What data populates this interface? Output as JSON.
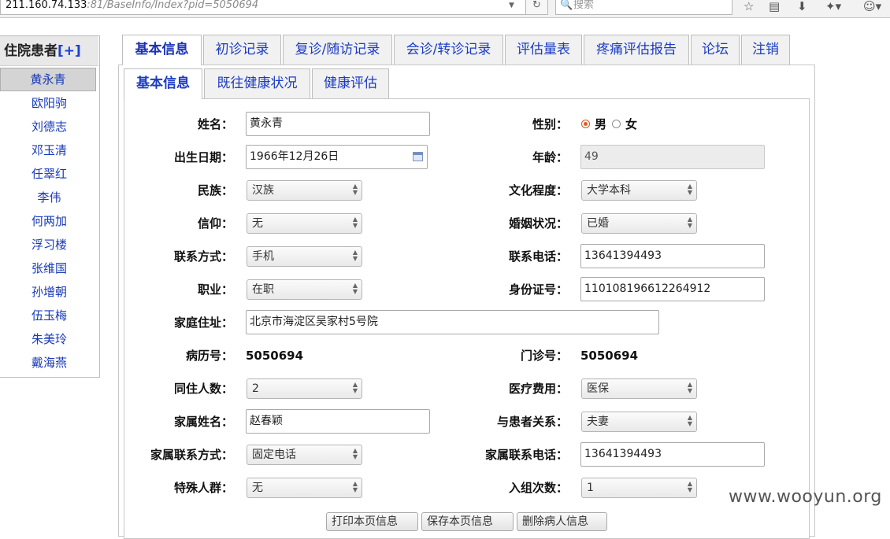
{
  "browser": {
    "url_host": "211.160.74.133",
    "url_rest": ":81/BaseInfo/Index?pid=5050694",
    "search_placeholder": "搜索"
  },
  "sidebar": {
    "title": "住院患者",
    "add_label": "[+]",
    "patients": [
      "黄永青",
      "欧阳驹",
      "刘德志",
      "邓玉清",
      "任翠红",
      "李伟",
      "何两加",
      "浮习楼",
      "张维国",
      "孙增朝",
      "伍玉梅",
      "朱美玲",
      "戴海燕"
    ]
  },
  "tabs": [
    "基本信息",
    "初诊记录",
    "复诊/随访记录",
    "会诊/转诊记录",
    "评估量表",
    "疼痛评估报告",
    "论坛",
    "注销"
  ],
  "subtabs": [
    "基本信息",
    "既往健康状况",
    "健康评估"
  ],
  "form": {
    "name_label": "姓名：",
    "name_value": "黄永青",
    "gender_label": "性别：",
    "gender_male": "男",
    "gender_female": "女",
    "birth_label": "出生日期：",
    "birth_value": "1966年12月26日",
    "age_label": "年龄：",
    "age_value": "49",
    "ethnic_label": "民族：",
    "ethnic_value": "汉族",
    "edu_label": "文化程度：",
    "edu_value": "大学本科",
    "faith_label": "信仰：",
    "faith_value": "无",
    "marital_label": "婚姻状况：",
    "marital_value": "已婚",
    "contact_label": "联系方式：",
    "contact_value": "手机",
    "phone_label": "联系电话：",
    "phone_value": "13641394493",
    "job_label": "职业：",
    "job_value": "在职",
    "id_label": "身份证号：",
    "id_value": "110108196612264912",
    "address_label": "家庭住址：",
    "address_value": "北京市海淀区吴家村5号院",
    "record_label": "病历号：",
    "record_value": "5050694",
    "clinic_label": "门诊号：",
    "clinic_value": "5050694",
    "cohab_label": "同住人数：",
    "cohab_value": "2",
    "fee_label": "医疗费用：",
    "fee_value": "医保",
    "family_name_label": "家属姓名：",
    "family_name_value": "赵春颖",
    "relation_label": "与患者关系：",
    "relation_value": "夫妻",
    "family_contact_label": "家属联系方式：",
    "family_contact_value": "固定电话",
    "family_phone_label": "家属联系电话：",
    "family_phone_value": "13641394493",
    "special_label": "特殊人群：",
    "special_value": "无",
    "group_label": "入组次数：",
    "group_value": "1"
  },
  "buttons": {
    "print": "打印本页信息",
    "save": "保存本页信息",
    "delete": "删除病人信息"
  },
  "watermark": "www.wooyun.org"
}
